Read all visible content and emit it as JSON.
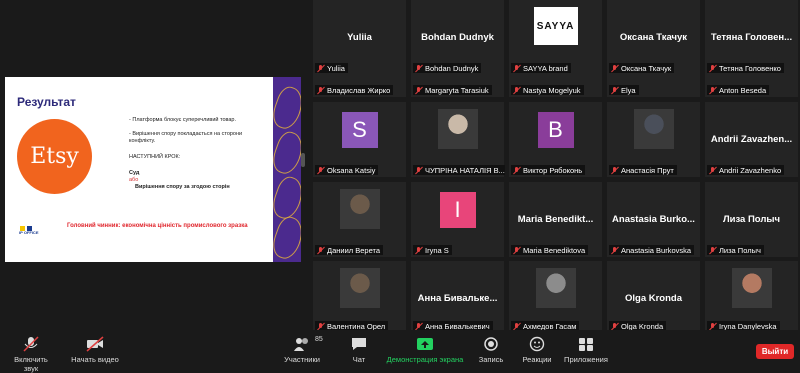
{
  "slide": {
    "title": "Результат",
    "logo_text": "Etsy",
    "bullet1": "- Платформа блокує суперечливий товар.",
    "bullet2": "- Вирішення спору покладається на сторони конфлікту.",
    "next_step": "НАСТУПНИЙ КРОК:",
    "opt1": "Суд",
    "or": "або",
    "opt2": "Вирішення спору за згодою сторін",
    "footer": "Головний чинник: економічна цінність промислового зразка",
    "office_logo": "IP OFFICE"
  },
  "participants": [
    {
      "name": "Владислав Жир...",
      "label": "Владислав Жирко"
    },
    {
      "name": "Margaryta Tarasi...",
      "label": "Margaryta Tarasiuk"
    },
    {
      "name": "Nastya Mogelyuk",
      "label": "Nastya Mogelyuk"
    },
    {
      "name": "Elya",
      "label": "Elya"
    },
    {
      "name": "Anton Beseda",
      "label": "Anton Beseda"
    },
    {
      "name": "",
      "label": "Oksana Katsiy",
      "avatar": "S",
      "avatar_color": "#8a57b8"
    },
    {
      "name": "",
      "label": "ЧУПРІНА НАТАЛІЯ В..."
    },
    {
      "name": "",
      "label": "Виктор Рябоконь",
      "avatar": "B",
      "avatar_color": "#8a3d9a"
    },
    {
      "name": "",
      "label": "Анастасія Прут"
    },
    {
      "name": "Andrii Zavazhen...",
      "label": "Andrii Zavazhenko"
    },
    {
      "name": "",
      "label": "Даниил Верета"
    },
    {
      "name": "",
      "label": "Iryna S",
      "avatar": "I",
      "avatar_color": "#e8457a"
    },
    {
      "name": "Maria Benedikt...",
      "label": "Maria Benediktova"
    },
    {
      "name": "Anastasia Burko...",
      "label": "Anastasia Burkovska"
    },
    {
      "name": "Лиза Полыч",
      "label": "Лиза Полыч"
    },
    {
      "name": "",
      "label": "Валентина Орел"
    },
    {
      "name": "Анна Бивальке...",
      "label": "Анна Бивалькевич"
    },
    {
      "name": "",
      "label": "Ахмедов Гасам"
    },
    {
      "name": "Olga Kronda",
      "label": "Olga Kronda"
    },
    {
      "name": "",
      "label": "Iryna Danylevska"
    },
    {
      "name": "Yuliia",
      "label": "Yuliia"
    },
    {
      "name": "Bohdan Dudnyk",
      "label": "Bohdan Dudnyk"
    },
    {
      "name": "",
      "label": "SAYYA brand",
      "logo": "SAYYA"
    },
    {
      "name": "Оксана Ткачук",
      "label": "Оксана Ткачук"
    },
    {
      "name": "Тетяна Головен...",
      "label": "Тетяна Головенко"
    }
  ],
  "toolbar": {
    "unmute": "Включить звук",
    "video": "Начать видео",
    "participants": "Участники",
    "participants_count": "85",
    "chat": "Чат",
    "share": "Демонстрация экрана",
    "record": "Запись",
    "reactions": "Реакции",
    "apps": "Приложения",
    "leave": "Выйти"
  },
  "colors": {
    "accent_green": "#23d160",
    "leave_red": "#e02828"
  }
}
